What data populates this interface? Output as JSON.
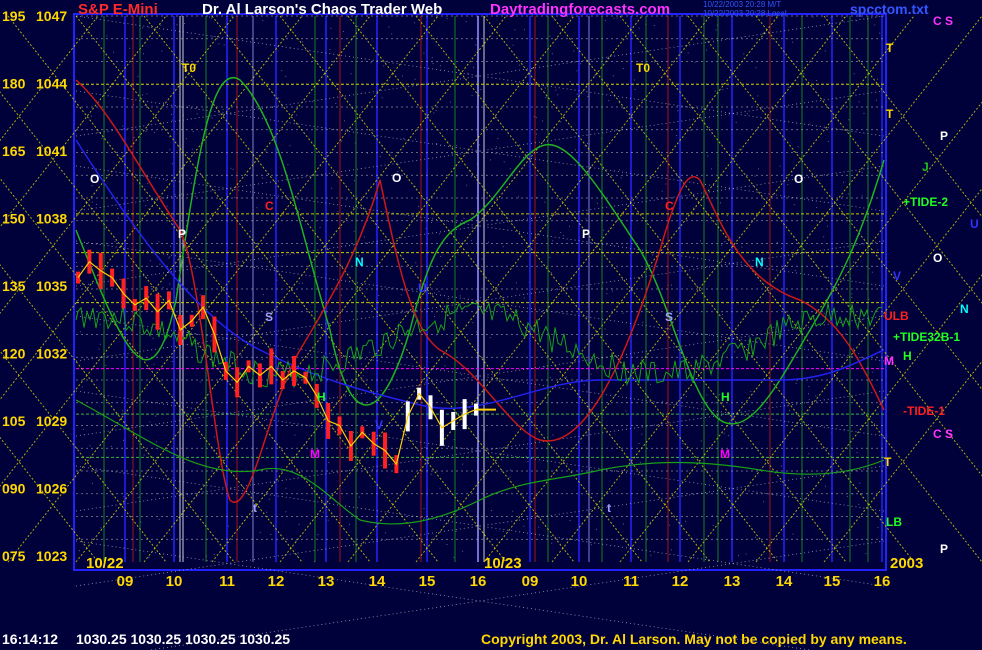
{
  "header": {
    "instrument": "S&P E-Mini",
    "author": "Dr. Al Larson's Chaos Trader Web",
    "site": "Daytradingforecasts.com",
    "stamp1": "10/22/2003 20:28 M/T",
    "stamp2": "10/22/2003 20:28 Local",
    "file": "spcctom.txt"
  },
  "footer": {
    "time": "16:14:12",
    "quote": "1030.25 1030.25 1030.25 1030.25",
    "copyright": "Copyright 2003, Dr. Al Larson. May not be copied by any means."
  },
  "colors": {
    "background": "#00003a",
    "grid_yellow": "#d8d800",
    "price": "#ff2020",
    "price_body": "#ffd000",
    "recent_price": "#ffffff",
    "tide_green": "#18a018",
    "tide_red": "#c81818",
    "blue_line": "#2020e0",
    "accent_magenta": "#ff00ff"
  },
  "chart_data": {
    "type": "line",
    "title": "S&P E-Mini",
    "y_left_ticks": [
      "195",
      "180",
      "165",
      "150",
      "135",
      "120",
      "105",
      "090",
      "075"
    ],
    "y_price_ticks": [
      "1047",
      "1044",
      "1041",
      "1038",
      "1035",
      "1032",
      "1029",
      "1026",
      "1023"
    ],
    "ylim": [
      1023,
      1047
    ],
    "x_hour_labels": [
      "09",
      "10",
      "11",
      "12",
      "13",
      "14",
      "15",
      "16",
      "09",
      "10",
      "11",
      "12",
      "13",
      "14",
      "15",
      "16"
    ],
    "date_labels": [
      "10/22",
      "10/23"
    ],
    "year_label": "2003",
    "right_labels": [
      "C S",
      "T",
      "T",
      "P",
      "J",
      "+TIDE-2",
      "U",
      "O",
      "V",
      "N",
      "ULB",
      "+TIDE32B-1",
      "H",
      "M",
      "-TIDE-1",
      "C S",
      "T",
      "LB",
      "P"
    ],
    "chart_labels": [
      "T0",
      "T0",
      "O",
      "O",
      "O",
      "P",
      "P",
      "C",
      "C",
      "N",
      "N",
      "S",
      "S",
      "H",
      "H",
      "M",
      "M",
      "t",
      "t",
      "U",
      "V"
    ],
    "series": [
      {
        "name": "S&P E-Mini",
        "values": [
          1035.5,
          1036.2,
          1035.8,
          1035.5,
          1034.8,
          1034.3,
          1034.6,
          1034.0,
          1034.5,
          1033.2,
          1033.6,
          1034.2,
          1033.0,
          1031.4,
          1030.9,
          1031.6,
          1031.2,
          1031.6,
          1031.0,
          1031.4,
          1031.1,
          1030.3,
          1029.2,
          1029.0,
          1028.1,
          1028.7,
          1028.2,
          1027.9,
          1027.3,
          1029.4,
          1030.4,
          1029.8,
          1028.9,
          1029.2,
          1029.5,
          1029.7
        ]
      },
      {
        "name": "+TIDE-2"
      },
      {
        "name": "+TIDE32B-1"
      },
      {
        "name": "-TIDE-1"
      }
    ]
  }
}
